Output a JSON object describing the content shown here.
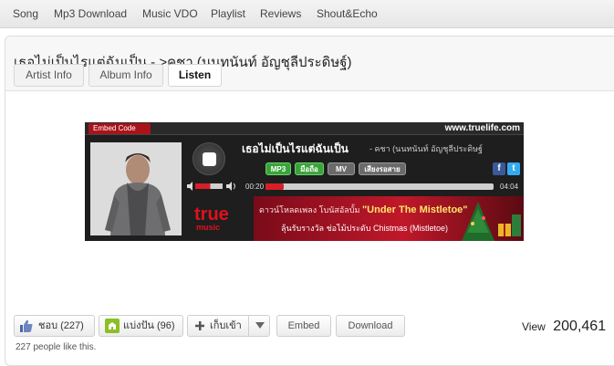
{
  "nav": {
    "items": [
      "Song",
      "Mp3 Download",
      "Music VDO",
      "Playlist",
      "Reviews",
      "Shout&Echo"
    ]
  },
  "page": {
    "title": "เธอไม่เป็นไรแต่ฉันเป็น - >คชา (นนทนันท์ อัญชุลีประดิษฐ์)"
  },
  "tabs": [
    {
      "label": "Artist Info",
      "active": false
    },
    {
      "label": "Album Info",
      "active": false
    },
    {
      "label": "Listen",
      "active": true
    }
  ],
  "player": {
    "embed_label": "Embed Code",
    "site": "www.truelife.com",
    "song_title": "เธอไม่เป็นไรแต่ฉันเป็น",
    "song_artist": "-  คชา (นนทนันท์ อัญชุลีประดิษฐ์",
    "buttons": [
      "MP3",
      "มือถือ",
      "MV",
      "เสียงรอสาย"
    ],
    "social": [
      "f",
      "t"
    ],
    "time_elapsed": "00:20",
    "time_total": "04:04",
    "progress": 0.08,
    "volume": 0.55,
    "logo_main": "true",
    "logo_sub": "music",
    "banner_line1_pre": "ดาวน์โหลดเพลง โบนัสอัลบั้ม",
    "banner_line1_highlight": "\"Under The Mistletoe\"",
    "banner_line2": "ลุ้นรับรางวัล ช่อไม้ประดับ Chistmas (Mistletoe)",
    "colors": {
      "accent": "#d81e27",
      "mp3": "#3aa33a",
      "bg": "#1e1e1e"
    }
  },
  "actions": {
    "like_label": "ชอบ (227)",
    "share_label": "แบ่งปัน (96)",
    "save_label": "เก็บเข้า",
    "embed_label": "Embed",
    "download_label": "Download",
    "likes_note": "227 people like this.",
    "views_label": "View",
    "views_count": "200,461"
  }
}
